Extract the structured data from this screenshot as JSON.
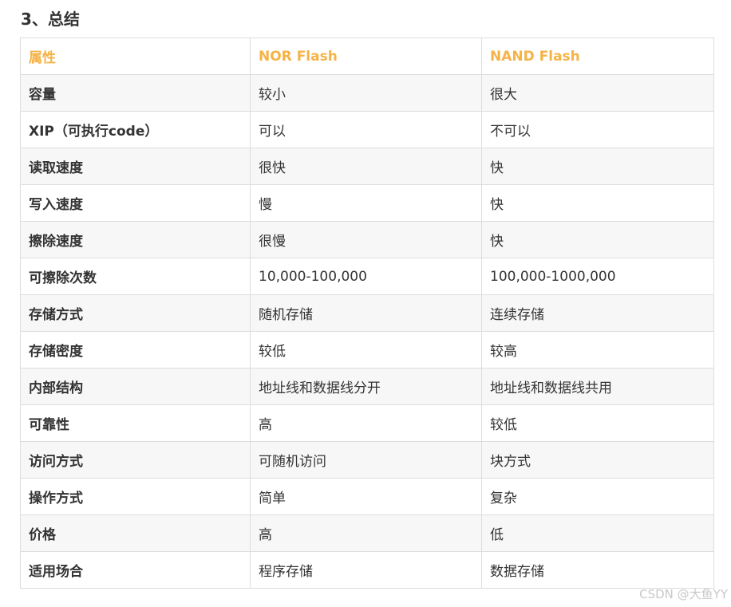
{
  "section": {
    "title": "3、总结"
  },
  "table": {
    "headers": [
      "属性",
      "NOR Flash",
      "NAND Flash"
    ],
    "rows": [
      [
        "容量",
        "较小",
        "很大"
      ],
      [
        "XIP（可执行code）",
        "可以",
        "不可以"
      ],
      [
        "读取速度",
        "很快",
        "快"
      ],
      [
        "写入速度",
        "慢",
        "快"
      ],
      [
        "擦除速度",
        "很慢",
        "快"
      ],
      [
        "可擦除次数",
        "10,000-100,000",
        "100,000-1000,000"
      ],
      [
        "存储方式",
        "随机存储",
        "连续存储"
      ],
      [
        "存储密度",
        "较低",
        "较高"
      ],
      [
        "内部结构",
        "地址线和数据线分开",
        "地址线和数据线共用"
      ],
      [
        "可靠性",
        "高",
        "较低"
      ],
      [
        "访问方式",
        "可随机访问",
        "块方式"
      ],
      [
        "操作方式",
        "简单",
        "复杂"
      ],
      [
        "价格",
        "高",
        "低"
      ],
      [
        "适用场合",
        "程序存储",
        "数据存储"
      ]
    ]
  },
  "watermark": "CSDN @大鱼YY",
  "colors": {
    "header_text": "#f5b347",
    "body_text": "#333333",
    "stripe": "#f7f7f7",
    "border": "#dddddd"
  }
}
